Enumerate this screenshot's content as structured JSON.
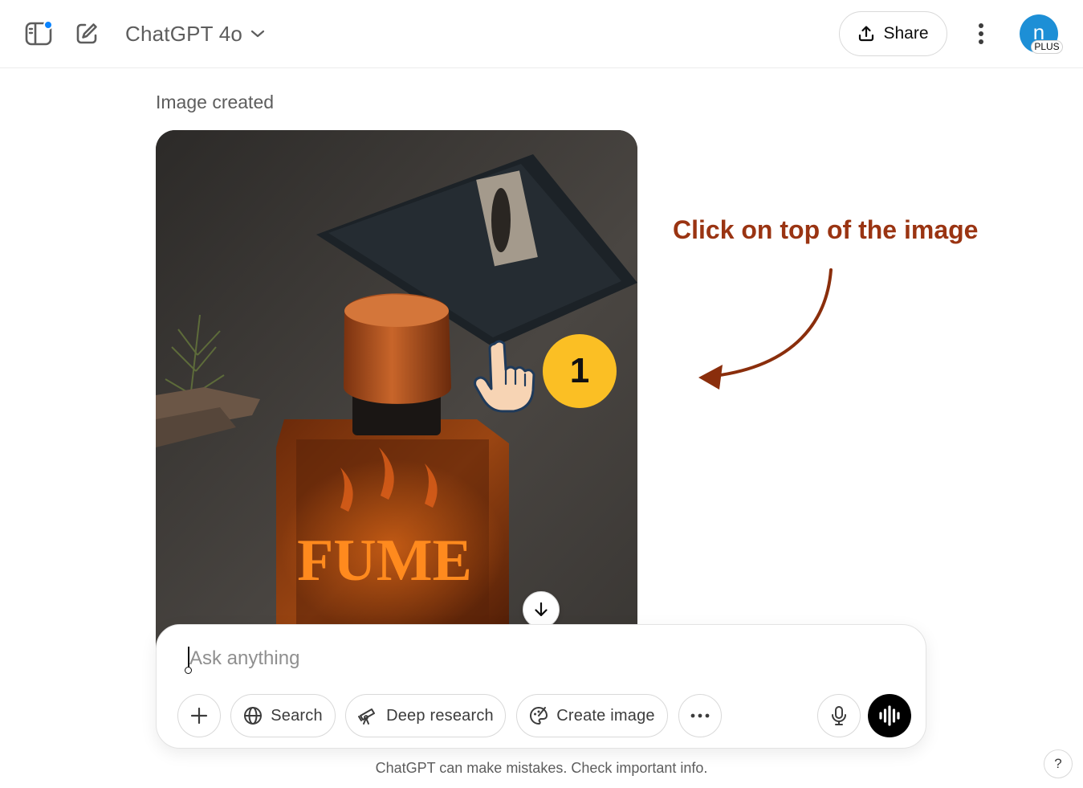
{
  "header": {
    "model_name": "ChatGPT 4o",
    "share_label": "Share",
    "avatar_letter": "n",
    "plan_badge": "PLUS",
    "icons": [
      "sidebar-icon",
      "new-chat-icon",
      "chevron-down-icon",
      "share-icon",
      "more-vertical-icon"
    ]
  },
  "message": {
    "status": "Image created",
    "image_text": "FUME"
  },
  "annotation": {
    "instruction": "Click on top of the image",
    "step_number": "1",
    "color": "#9a3412",
    "badge_color": "#fbbf24"
  },
  "composer": {
    "placeholder": "Ask anything",
    "tools": {
      "search": "Search",
      "deep_research": "Deep research",
      "create_image": "Create image"
    }
  },
  "footer": {
    "disclaimer": "ChatGPT can make mistakes. Check important info.",
    "help": "?"
  }
}
